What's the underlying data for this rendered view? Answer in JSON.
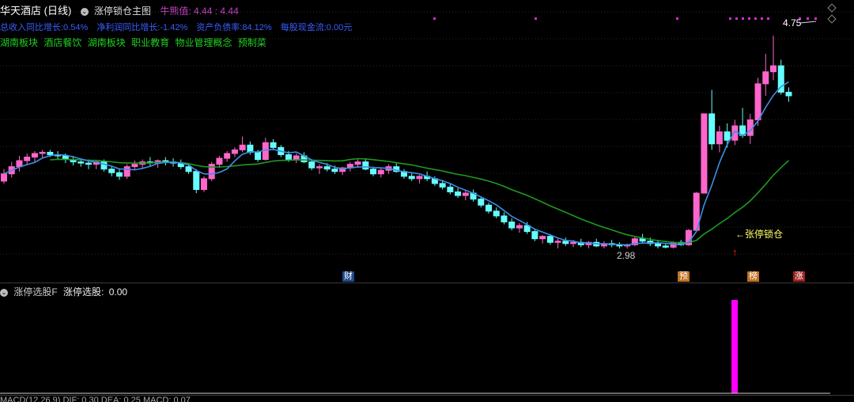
{
  "header": {
    "stock": "华天酒店 (日线)",
    "indicator": "涨停锁仓主图",
    "bull_label": "牛熊值:",
    "bull_value": "4.44",
    "bull_value2": "4.44",
    "colors": {
      "title": "#ffffff",
      "bull": "#c040c0"
    }
  },
  "fundamentals": [
    "总收入同比增长:0.54%",
    "净利润同比增长:-1.42%",
    "资产负债率:84.12%",
    "每股现金流:0.00元"
  ],
  "concepts": [
    "湖南板块",
    "酒店餐饮",
    "湖南板块",
    "职业教育",
    "物业管理概念",
    "预制菜"
  ],
  "markers": {
    "cai": "财",
    "yu": "预",
    "bang": "榜",
    "zhang": "涨",
    "lock_label": "←张停锁仓",
    "high_label": "4.75",
    "low_label": "2.98"
  },
  "sub_panel": {
    "name": "涨停选股F",
    "label": "涨停选股:",
    "value": "0.00"
  },
  "macd_line": "MACD(12,26,9)  DIF: 0.30  DEA: 0.25  MACD: 0.07",
  "chart_data": {
    "type": "candlestick",
    "up_color": "#ff66cc",
    "down_color": "#66ffff",
    "ma_long_color": "#1f9a1f",
    "ma_short_color": "#3b8fe6",
    "ylim": [
      2.9,
      4.85
    ],
    "annotations": {
      "high": 4.75,
      "low": 2.98
    },
    "candles": [
      [
        3.54,
        3.64,
        3.52,
        3.6
      ],
      [
        3.6,
        3.7,
        3.57,
        3.66
      ],
      [
        3.66,
        3.75,
        3.62,
        3.71
      ],
      [
        3.71,
        3.77,
        3.67,
        3.74
      ],
      [
        3.74,
        3.79,
        3.7,
        3.77
      ],
      [
        3.77,
        3.8,
        3.73,
        3.78
      ],
      [
        3.78,
        3.8,
        3.74,
        3.76
      ],
      [
        3.76,
        3.79,
        3.72,
        3.75
      ],
      [
        3.75,
        3.77,
        3.69,
        3.72
      ],
      [
        3.72,
        3.75,
        3.67,
        3.7
      ],
      [
        3.7,
        3.73,
        3.66,
        3.69
      ],
      [
        3.69,
        3.72,
        3.64,
        3.68
      ],
      [
        3.68,
        3.71,
        3.64,
        3.7
      ],
      [
        3.7,
        3.72,
        3.62,
        3.64
      ],
      [
        3.64,
        3.67,
        3.58,
        3.61
      ],
      [
        3.61,
        3.64,
        3.55,
        3.58
      ],
      [
        3.58,
        3.68,
        3.56,
        3.66
      ],
      [
        3.66,
        3.71,
        3.63,
        3.68
      ],
      [
        3.68,
        3.72,
        3.64,
        3.7
      ],
      [
        3.7,
        3.74,
        3.66,
        3.69
      ],
      [
        3.69,
        3.72,
        3.65,
        3.71
      ],
      [
        3.71,
        3.74,
        3.67,
        3.7
      ],
      [
        3.7,
        3.73,
        3.66,
        3.69
      ],
      [
        3.69,
        3.72,
        3.64,
        3.66
      ],
      [
        3.66,
        3.69,
        3.6,
        3.62
      ],
      [
        3.62,
        3.64,
        3.44,
        3.47
      ],
      [
        3.47,
        3.58,
        3.45,
        3.56
      ],
      [
        3.56,
        3.7,
        3.54,
        3.68
      ],
      [
        3.68,
        3.75,
        3.65,
        3.73
      ],
      [
        3.73,
        3.79,
        3.7,
        3.77
      ],
      [
        3.77,
        3.82,
        3.74,
        3.8
      ],
      [
        3.8,
        3.91,
        3.78,
        3.84
      ],
      [
        3.84,
        3.87,
        3.76,
        3.78
      ],
      [
        3.78,
        3.8,
        3.7,
        3.72
      ],
      [
        3.72,
        3.9,
        3.71,
        3.86
      ],
      [
        3.86,
        3.89,
        3.8,
        3.82
      ],
      [
        3.82,
        3.84,
        3.74,
        3.76
      ],
      [
        3.76,
        3.79,
        3.7,
        3.72
      ],
      [
        3.72,
        3.77,
        3.69,
        3.75
      ],
      [
        3.75,
        3.78,
        3.69,
        3.7
      ],
      [
        3.7,
        3.72,
        3.63,
        3.65
      ],
      [
        3.65,
        3.68,
        3.6,
        3.66
      ],
      [
        3.66,
        3.69,
        3.62,
        3.64
      ],
      [
        3.64,
        3.67,
        3.6,
        3.62
      ],
      [
        3.62,
        3.66,
        3.59,
        3.65
      ],
      [
        3.65,
        3.7,
        3.62,
        3.68
      ],
      [
        3.68,
        3.72,
        3.65,
        3.7
      ],
      [
        3.7,
        3.72,
        3.63,
        3.64
      ],
      [
        3.64,
        3.66,
        3.58,
        3.6
      ],
      [
        3.6,
        3.65,
        3.57,
        3.63
      ],
      [
        3.63,
        3.68,
        3.6,
        3.66
      ],
      [
        3.66,
        3.69,
        3.61,
        3.62
      ],
      [
        3.62,
        3.64,
        3.56,
        3.58
      ],
      [
        3.58,
        3.61,
        3.54,
        3.56
      ],
      [
        3.56,
        3.59,
        3.52,
        3.58
      ],
      [
        3.58,
        3.62,
        3.54,
        3.56
      ],
      [
        3.56,
        3.58,
        3.5,
        3.52
      ],
      [
        3.52,
        3.55,
        3.47,
        3.49
      ],
      [
        3.49,
        3.52,
        3.43,
        3.45
      ],
      [
        3.45,
        3.48,
        3.4,
        3.42
      ],
      [
        3.42,
        3.46,
        3.38,
        3.44
      ],
      [
        3.44,
        3.47,
        3.37,
        3.39
      ],
      [
        3.39,
        3.41,
        3.32,
        3.34
      ],
      [
        3.34,
        3.36,
        3.27,
        3.29
      ],
      [
        3.29,
        3.32,
        3.23,
        3.25
      ],
      [
        3.25,
        3.28,
        3.18,
        3.2
      ],
      [
        3.2,
        3.23,
        3.13,
        3.15
      ],
      [
        3.15,
        3.19,
        3.11,
        3.17
      ],
      [
        3.17,
        3.2,
        3.1,
        3.12
      ],
      [
        3.12,
        3.14,
        3.04,
        3.06
      ],
      [
        3.06,
        3.09,
        3.02,
        3.08
      ],
      [
        3.08,
        3.1,
        3.01,
        3.03
      ],
      [
        3.03,
        3.06,
        2.98,
        3.04
      ],
      [
        3.04,
        3.07,
        3.0,
        3.02
      ],
      [
        3.02,
        3.05,
        2.99,
        3.03
      ],
      [
        3.03,
        3.06,
        2.99,
        3.01
      ],
      [
        3.01,
        3.04,
        2.98,
        3.03
      ],
      [
        3.03,
        3.06,
        2.99,
        3.0
      ],
      [
        3.0,
        3.04,
        2.98,
        3.02
      ],
      [
        3.02,
        3.05,
        2.99,
        3.01
      ],
      [
        3.01,
        3.03,
        2.98,
        3.0
      ],
      [
        3.0,
        3.02,
        2.98,
        3.01
      ],
      [
        3.01,
        3.08,
        3.0,
        3.06
      ],
      [
        3.06,
        3.1,
        3.02,
        3.04
      ],
      [
        3.04,
        3.07,
        3.0,
        3.02
      ],
      [
        3.02,
        3.05,
        2.98,
        3.0
      ],
      [
        3.0,
        3.02,
        2.98,
        2.99
      ],
      [
        2.99,
        3.04,
        2.98,
        3.03
      ],
      [
        3.03,
        3.05,
        3.0,
        3.01
      ],
      [
        3.01,
        3.14,
        3.0,
        3.13
      ],
      [
        3.13,
        3.45,
        3.12,
        3.44
      ],
      [
        3.44,
        4.1,
        3.52,
        4.1
      ],
      [
        4.1,
        4.3,
        3.8,
        3.85
      ],
      [
        3.85,
        4.0,
        3.78,
        3.95
      ],
      [
        3.95,
        4.02,
        3.82,
        3.88
      ],
      [
        3.88,
        4.05,
        3.84,
        4.0
      ],
      [
        4.0,
        4.15,
        3.9,
        3.92
      ],
      [
        3.92,
        4.1,
        3.85,
        4.05
      ],
      [
        4.05,
        4.4,
        4.0,
        4.35
      ],
      [
        4.35,
        4.6,
        4.25,
        4.45
      ],
      [
        4.45,
        4.75,
        4.38,
        4.5
      ],
      [
        4.5,
        4.55,
        4.26,
        4.28
      ],
      [
        4.28,
        4.32,
        4.2,
        4.25
      ]
    ]
  }
}
